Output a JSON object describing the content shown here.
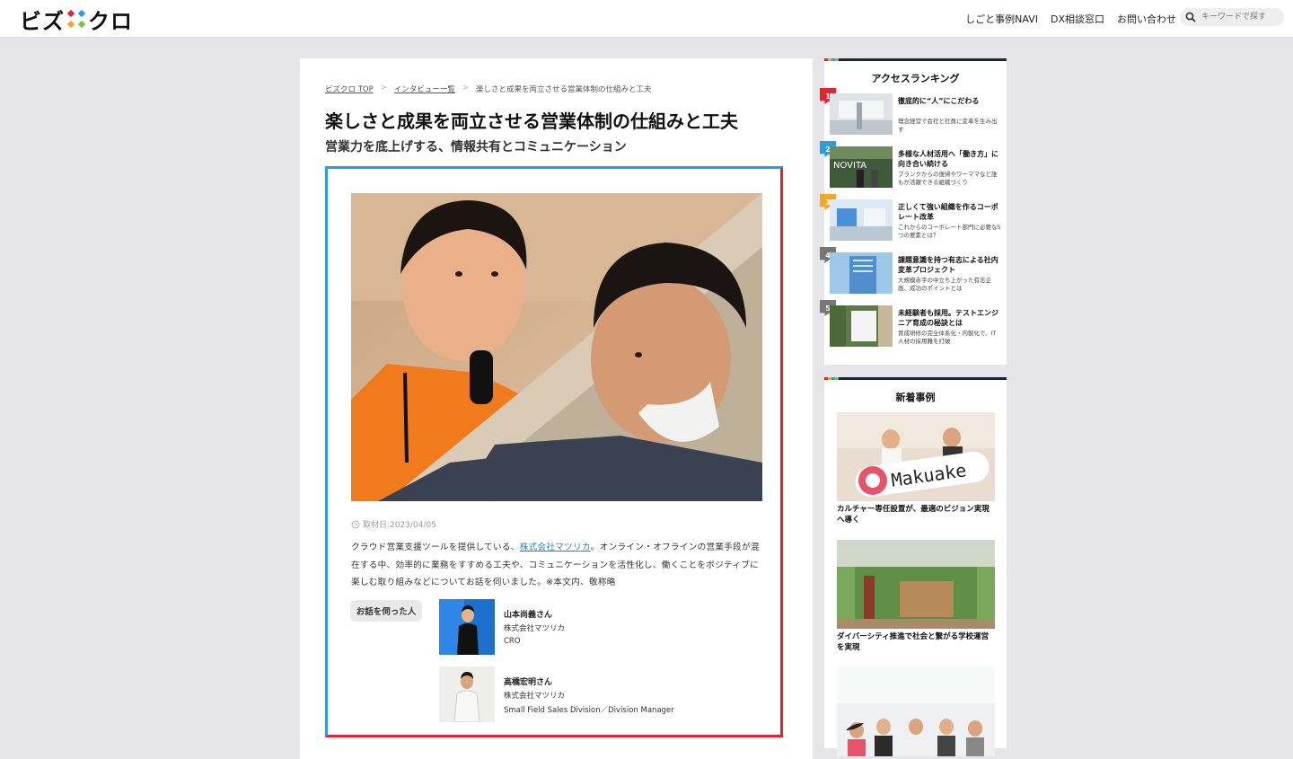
{
  "header": {
    "logo_text_left": "ビズ",
    "logo_text_right": "クロ",
    "nav": [
      "しごと事例NAVI",
      "DX相談窓口",
      "お問い合わせ"
    ],
    "search_placeholder": "キーワードで探す"
  },
  "breadcrumb": [
    "ビズクロ TOP",
    "インタビュー一覧",
    "楽しさと成果を両立させる営業体制の仕組みと工夫"
  ],
  "article": {
    "title": "楽しさと成果を両立させる営業体制の仕組みと工夫",
    "subtitle": "営業力を底上げする、情報共有とコミュニケーション",
    "date": "取材日:2023/04/05",
    "lead_before": "クラウド営業支援ツールを提供している、",
    "lead_link": "株式会社マツリカ",
    "lead_after": "。オンライン・オフラインの営業手段が混在する中、効率的に業務をすすめる工夫や、コミュニケーションを活性化し、働くことをポジティブに楽しむ取り組みなどについてお話を伺いました。※本文内、敬称略",
    "interviewee_label": "お話を伺った人",
    "people": [
      {
        "name": "山本尚義さん",
        "company": "株式会社マツリカ",
        "role": "CRO"
      },
      {
        "name": "高橋宏明さん",
        "company": "株式会社マツリカ",
        "role": "Small Field Sales Division／Division Manager"
      }
    ]
  },
  "ranking": {
    "title": "アクセスランキング",
    "items": [
      {
        "rank": "1",
        "color": "#e8232d",
        "title": "徹底的に“人”にこだわる",
        "desc": "理念経営で会社と社員に変革を生み出す"
      },
      {
        "rank": "2",
        "color": "#2a9fde",
        "title": "多様な人材活用へ「働き方」に向き合い続ける",
        "desc": "ブランクからの復帰やワーママなど誰もが活躍できる組織づくり"
      },
      {
        "rank": "3",
        "color": "#f5a623",
        "title": "正しくて強い組織を作るコーポレート改革",
        "desc": "これからのコーポレート部門に必要な5つの要素とは？"
      },
      {
        "rank": "4",
        "color": "#777777",
        "title": "課題意識を持つ有志による社内変革プロジェクト",
        "desc": "大規模赤字の中立ち上がった有志企画、成功のポイントとは"
      },
      {
        "rank": "5",
        "color": "#777777",
        "title": "未経験者も採用。テストエンジニア育成の秘訣とは",
        "desc": "育成研修の完全体系化・内製化で、IT人材の採用難を打破"
      }
    ]
  },
  "new_cases": {
    "title": "新着事例",
    "items": [
      {
        "title": "カルチャー専任設置が、最適のビジョン実現へ導く",
        "sign": "Makuake"
      },
      {
        "title": "ダイバーシティ推進で社会と繋がる学校運営を実現"
      },
      {
        "title": ""
      }
    ]
  },
  "hero_sign": "NOVITA"
}
